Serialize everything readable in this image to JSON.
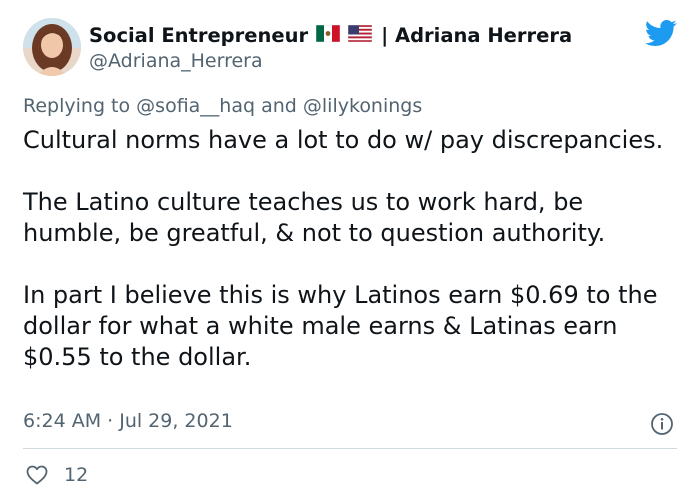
{
  "author": {
    "display_name": "Social Entrepreneur",
    "name_suffix": "| Adriana Herrera",
    "handle": "@Adriana_Herrera",
    "avatar_icon": "profile-photo",
    "flags": [
      "mexico-flag",
      "usa-flag"
    ]
  },
  "reply": {
    "prefix": "Replying to",
    "mention_1": "@sofia__haq",
    "conjunction": "and",
    "mention_2": "@lilykonings"
  },
  "tweet": {
    "paragraph_1": "Cultural norms have a lot to do w/ pay discrepancies.",
    "paragraph_2": "The Latino culture teaches us to work hard, be humble, be greatful, & not to question authority.",
    "paragraph_3": "In part I believe this is why Latinos earn $0.69 to the dollar for what a white male earns & Latinas earn $0.55 to the dollar.",
    "timestamp": "6:24 AM · Jul 29, 2021"
  },
  "engagement": {
    "likes": "12",
    "like_icon": "heart-icon",
    "info_icon": "info-icon"
  },
  "colors": {
    "twitter_blue": "#1d9bf0",
    "secondary_text": "#536471",
    "primary_text": "#0f1419"
  }
}
